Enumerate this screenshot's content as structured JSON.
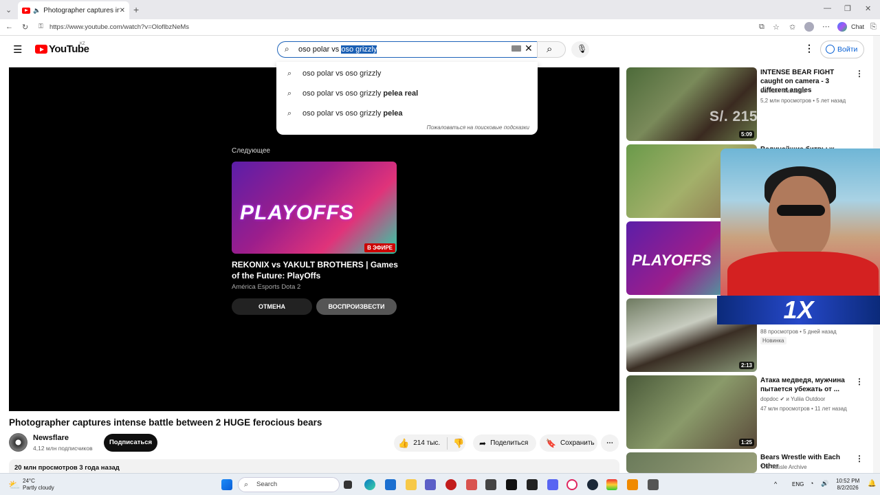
{
  "browser": {
    "tab_title": "Photographer captures inten",
    "url": "https://www.youtube.com/watch?v=OloflbzNeMs",
    "chat_label": "Chat"
  },
  "youtube": {
    "logo": "YouTube",
    "region": "KZ",
    "search_typed": "oso polar vs ",
    "search_selected": "oso grizzly",
    "signin_label": "Войти",
    "suggestions": [
      {
        "plain": "oso polar vs oso grizzly",
        "bold": ""
      },
      {
        "plain": "oso polar vs oso grizzly ",
        "bold": "pelea real"
      },
      {
        "plain": "oso polar vs oso grizzly ",
        "bold": "pelea"
      }
    ],
    "report_label": "Пожаловаться на поисковые подсказки"
  },
  "player": {
    "next_label": "Следующее",
    "next_thumb_text": "PLAYOFFS",
    "live_badge": "В ЭФИРЕ",
    "next_title": "REKONIX vs YAKULT BROTHERS | Games of the Future: PlayOffs",
    "next_channel": "América Esports Dota 2",
    "cancel_label": "ОТМЕНА",
    "play_label": "ВОСПРОИЗВЕСТИ"
  },
  "video": {
    "title": "Photographer captures intense battle between 2 HUGE ferocious bears",
    "channel": "Newsflare",
    "subscribers": "4,12 млн подписчиков",
    "subscribe_label": "Подписаться",
    "likes": "214 тыс.",
    "share_label": "Поделиться",
    "save_label": "Сохранить",
    "views_date": "20 млн просмотров  3 года назад"
  },
  "sidebar": [
    {
      "title": "INTENSE BEAR FIGHT caught on camera - 3 different angles",
      "channel": "Samulin Matkassa",
      "meta": "5,2 млн просмотров • 5 лет назад",
      "duration": "5:09"
    },
    {
      "title": "Величайшие битвы ж...",
      "channel": "",
      "meta": "",
      "duration": ""
    },
    {
      "title": "",
      "channel": "",
      "meta": "",
      "duration": ""
    },
    {
      "title": "",
      "channel": "",
      "meta": "88 просмотров • 5 дней назад",
      "badge": "Новинка",
      "duration": "2:13"
    },
    {
      "title": "Атака медведя, мужчина пытается убежать от ...",
      "channel": "dopdoc ✔ и Yuliia Outdoor",
      "meta": "47 млн просмотров • 11 лет назад",
      "duration": "1:25"
    },
    {
      "title": "Bears Wrestle with Each Other",
      "channel": "The Tussle Archive",
      "meta": "",
      "duration": ""
    }
  ],
  "overlay": {
    "ticker": "S/. 2156 LGD 2-0 x1.63",
    "brand": "1X"
  },
  "taskbar": {
    "temp": "24°C",
    "weather": "Partly cloudy",
    "search_label": "Search",
    "lang": "ENG",
    "time": "10:52 PM",
    "date": "8/2/2026"
  },
  "colors": {
    "accent": "#065fd4",
    "youtube_red": "#ff0000",
    "selection": "#1a5fb4"
  }
}
